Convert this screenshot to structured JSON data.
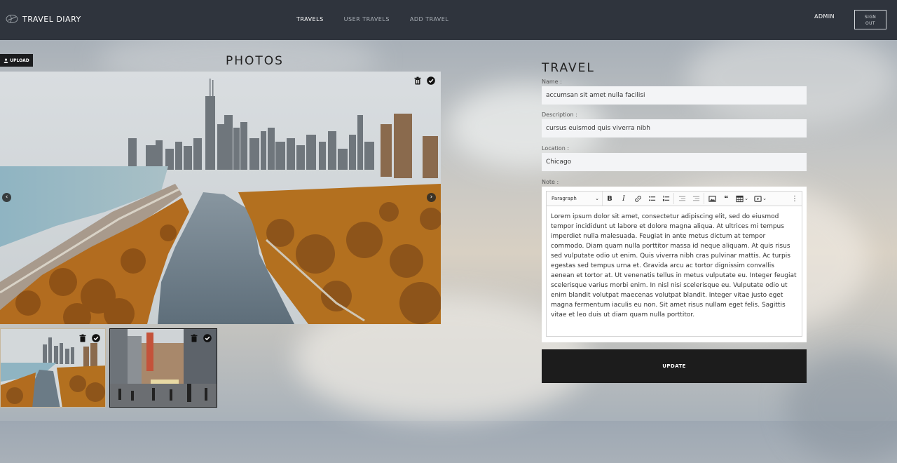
{
  "header": {
    "brand": "TRAVEL DIARY",
    "nav": [
      {
        "label": "TRAVELS",
        "active": true
      },
      {
        "label": "USER TRAVELS",
        "active": false
      },
      {
        "label": "ADD TRAVEL",
        "active": false
      }
    ],
    "user": "ADMIN",
    "signout": "SIGN\nOUT"
  },
  "photos": {
    "upload_label": "UPLOAD",
    "title": "PHOTOS",
    "main_icons": [
      "trash-icon",
      "check-circle-icon"
    ],
    "prev_icon": "arrow-left-icon",
    "next_icon": "arrow-right-icon",
    "thumbnails": [
      {
        "subject": "chicago skyline river",
        "icons": [
          "trash-icon",
          "check-circle-icon"
        ]
      },
      {
        "subject": "chicago theater street",
        "icons": [
          "trash-icon",
          "check-circle-icon"
        ]
      }
    ]
  },
  "travel": {
    "title": "TRAVEL",
    "name_label": "Name :",
    "name_value": "accumsan sit amet nulla facilisi",
    "description_label": "Description :",
    "description_value": "cursus euismod quis viverra nibh",
    "location_label": "Location :",
    "location_value": "Chicago",
    "note_label": "Note :",
    "toolbar": {
      "paragraph": "Paragraph",
      "buttons": [
        "bold-icon",
        "italic-icon",
        "link-icon",
        "bulleted-list-icon",
        "numbered-list-icon",
        "outdent-icon",
        "indent-icon",
        "image-icon",
        "blockquote-icon",
        "table-icon",
        "media-icon",
        "more-icon"
      ]
    },
    "note_text": "Lorem ipsum dolor sit amet, consectetur adipiscing elit, sed do eiusmod tempor incididunt ut labore et dolore magna aliqua. At ultrices mi tempus imperdiet nulla malesuada. Feugiat in ante metus dictum at tempor commodo. Diam quam nulla porttitor massa id neque aliquam. At quis risus sed vulputate odio ut enim. Quis viverra nibh cras pulvinar mattis. Ac turpis egestas sed tempus urna et. Gravida arcu ac tortor dignissim convallis aenean et tortor at. Ut venenatis tellus in metus vulputate eu. Integer feugiat scelerisque varius morbi enim. In nisl nisi scelerisque eu. Vulputate odio ut enim blandit volutpat maecenas volutpat blandit. Integer vitae justo eget magna fermentum iaculis eu non. Sit amet risus nullam eget felis. Sagittis vitae et leo duis ut diam quam nulla porttitor.",
    "update_label": "UPDATE"
  }
}
